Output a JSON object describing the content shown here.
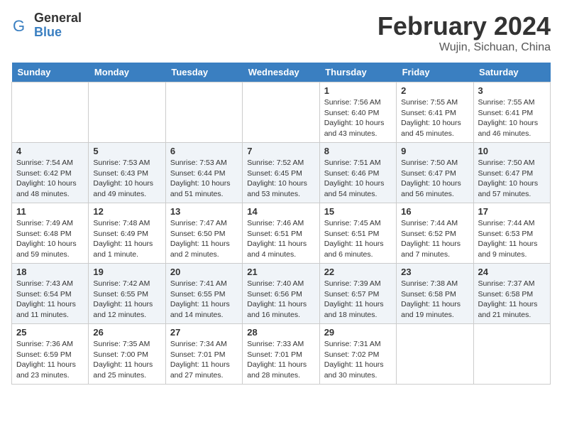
{
  "header": {
    "logo_general": "General",
    "logo_blue": "Blue",
    "month": "February 2024",
    "location": "Wujin, Sichuan, China"
  },
  "days_of_week": [
    "Sunday",
    "Monday",
    "Tuesday",
    "Wednesday",
    "Thursday",
    "Friday",
    "Saturday"
  ],
  "weeks": [
    [
      {
        "day": "",
        "info": ""
      },
      {
        "day": "",
        "info": ""
      },
      {
        "day": "",
        "info": ""
      },
      {
        "day": "",
        "info": ""
      },
      {
        "day": "1",
        "info": "Sunrise: 7:56 AM\nSunset: 6:40 PM\nDaylight: 10 hours\nand 43 minutes."
      },
      {
        "day": "2",
        "info": "Sunrise: 7:55 AM\nSunset: 6:41 PM\nDaylight: 10 hours\nand 45 minutes."
      },
      {
        "day": "3",
        "info": "Sunrise: 7:55 AM\nSunset: 6:41 PM\nDaylight: 10 hours\nand 46 minutes."
      }
    ],
    [
      {
        "day": "4",
        "info": "Sunrise: 7:54 AM\nSunset: 6:42 PM\nDaylight: 10 hours\nand 48 minutes."
      },
      {
        "day": "5",
        "info": "Sunrise: 7:53 AM\nSunset: 6:43 PM\nDaylight: 10 hours\nand 49 minutes."
      },
      {
        "day": "6",
        "info": "Sunrise: 7:53 AM\nSunset: 6:44 PM\nDaylight: 10 hours\nand 51 minutes."
      },
      {
        "day": "7",
        "info": "Sunrise: 7:52 AM\nSunset: 6:45 PM\nDaylight: 10 hours\nand 53 minutes."
      },
      {
        "day": "8",
        "info": "Sunrise: 7:51 AM\nSunset: 6:46 PM\nDaylight: 10 hours\nand 54 minutes."
      },
      {
        "day": "9",
        "info": "Sunrise: 7:50 AM\nSunset: 6:47 PM\nDaylight: 10 hours\nand 56 minutes."
      },
      {
        "day": "10",
        "info": "Sunrise: 7:50 AM\nSunset: 6:47 PM\nDaylight: 10 hours\nand 57 minutes."
      }
    ],
    [
      {
        "day": "11",
        "info": "Sunrise: 7:49 AM\nSunset: 6:48 PM\nDaylight: 10 hours\nand 59 minutes."
      },
      {
        "day": "12",
        "info": "Sunrise: 7:48 AM\nSunset: 6:49 PM\nDaylight: 11 hours\nand 1 minute."
      },
      {
        "day": "13",
        "info": "Sunrise: 7:47 AM\nSunset: 6:50 PM\nDaylight: 11 hours\nand 2 minutes."
      },
      {
        "day": "14",
        "info": "Sunrise: 7:46 AM\nSunset: 6:51 PM\nDaylight: 11 hours\nand 4 minutes."
      },
      {
        "day": "15",
        "info": "Sunrise: 7:45 AM\nSunset: 6:51 PM\nDaylight: 11 hours\nand 6 minutes."
      },
      {
        "day": "16",
        "info": "Sunrise: 7:44 AM\nSunset: 6:52 PM\nDaylight: 11 hours\nand 7 minutes."
      },
      {
        "day": "17",
        "info": "Sunrise: 7:44 AM\nSunset: 6:53 PM\nDaylight: 11 hours\nand 9 minutes."
      }
    ],
    [
      {
        "day": "18",
        "info": "Sunrise: 7:43 AM\nSunset: 6:54 PM\nDaylight: 11 hours\nand 11 minutes."
      },
      {
        "day": "19",
        "info": "Sunrise: 7:42 AM\nSunset: 6:55 PM\nDaylight: 11 hours\nand 12 minutes."
      },
      {
        "day": "20",
        "info": "Sunrise: 7:41 AM\nSunset: 6:55 PM\nDaylight: 11 hours\nand 14 minutes."
      },
      {
        "day": "21",
        "info": "Sunrise: 7:40 AM\nSunset: 6:56 PM\nDaylight: 11 hours\nand 16 minutes."
      },
      {
        "day": "22",
        "info": "Sunrise: 7:39 AM\nSunset: 6:57 PM\nDaylight: 11 hours\nand 18 minutes."
      },
      {
        "day": "23",
        "info": "Sunrise: 7:38 AM\nSunset: 6:58 PM\nDaylight: 11 hours\nand 19 minutes."
      },
      {
        "day": "24",
        "info": "Sunrise: 7:37 AM\nSunset: 6:58 PM\nDaylight: 11 hours\nand 21 minutes."
      }
    ],
    [
      {
        "day": "25",
        "info": "Sunrise: 7:36 AM\nSunset: 6:59 PM\nDaylight: 11 hours\nand 23 minutes."
      },
      {
        "day": "26",
        "info": "Sunrise: 7:35 AM\nSunset: 7:00 PM\nDaylight: 11 hours\nand 25 minutes."
      },
      {
        "day": "27",
        "info": "Sunrise: 7:34 AM\nSunset: 7:01 PM\nDaylight: 11 hours\nand 27 minutes."
      },
      {
        "day": "28",
        "info": "Sunrise: 7:33 AM\nSunset: 7:01 PM\nDaylight: 11 hours\nand 28 minutes."
      },
      {
        "day": "29",
        "info": "Sunrise: 7:31 AM\nSunset: 7:02 PM\nDaylight: 11 hours\nand 30 minutes."
      },
      {
        "day": "",
        "info": ""
      },
      {
        "day": "",
        "info": ""
      }
    ]
  ]
}
